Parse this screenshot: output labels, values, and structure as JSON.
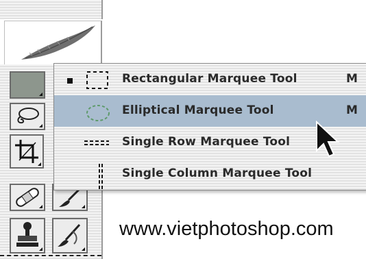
{
  "flyout_menu": {
    "items": [
      {
        "label": "Rectangular Marquee Tool",
        "shortcut": "M",
        "selected": true,
        "highlighted": false,
        "icon": "rectangular-marquee-icon"
      },
      {
        "label": "Elliptical Marquee Tool",
        "shortcut": "M",
        "selected": false,
        "highlighted": true,
        "icon": "elliptical-marquee-icon"
      },
      {
        "label": "Single Row Marquee Tool",
        "shortcut": "",
        "selected": false,
        "highlighted": false,
        "icon": "single-row-marquee-icon"
      },
      {
        "label": "Single Column Marquee Tool",
        "shortcut": "",
        "selected": false,
        "highlighted": false,
        "icon": "single-column-marquee-icon"
      }
    ]
  },
  "toolbox": {
    "logo_icon": "feather-icon",
    "tools": [
      "marquee-tool",
      "lasso-tool",
      "crop-tool",
      "healing-brush-tool",
      "brush-tool",
      "clone-stamp-tool",
      "history-brush-tool"
    ]
  },
  "watermark": {
    "text": "www.vietphotoshop.com"
  },
  "colors": {
    "highlight": "#a9bccf",
    "active_tool": "#8d968d",
    "stripe_light": "#f4f4f4",
    "stripe_dark": "#e2e2e2"
  }
}
